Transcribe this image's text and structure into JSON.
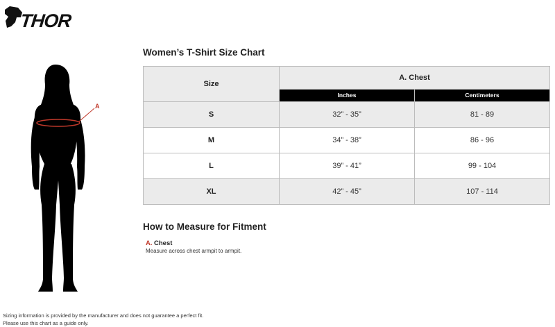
{
  "brand": {
    "logo_text": "THOR"
  },
  "chart": {
    "title": "Women’s T-Shirt Size Chart",
    "size_header": "Size",
    "group_header": "A. Chest",
    "unit_headers": [
      "Inches",
      "Centimeters"
    ],
    "rows": [
      {
        "size": "S",
        "inches": "32” - 35”",
        "cm": "81 - 89"
      },
      {
        "size": "M",
        "inches": "34” - 38”",
        "cm": "86 - 96"
      },
      {
        "size": "L",
        "inches": "39” - 41”",
        "cm": "99 - 104"
      },
      {
        "size": "XL",
        "inches": "42” - 45”",
        "cm": "107 - 114"
      }
    ]
  },
  "diagram": {
    "marker_label": "A"
  },
  "measure": {
    "title": "How to Measure for Fitment",
    "items": [
      {
        "letter": "A.",
        "label": "Chest",
        "description": "Measure across chest armpit to armpit."
      }
    ]
  },
  "footer": {
    "line1": "Sizing information is provided by the manufacturer and does not guarantee a perfect fit.",
    "line2": "Please use this chart as a guide only."
  },
  "colors": {
    "accent": "#c0392b",
    "header_bg": "#ebebeb",
    "subheader_bg": "#000000"
  }
}
